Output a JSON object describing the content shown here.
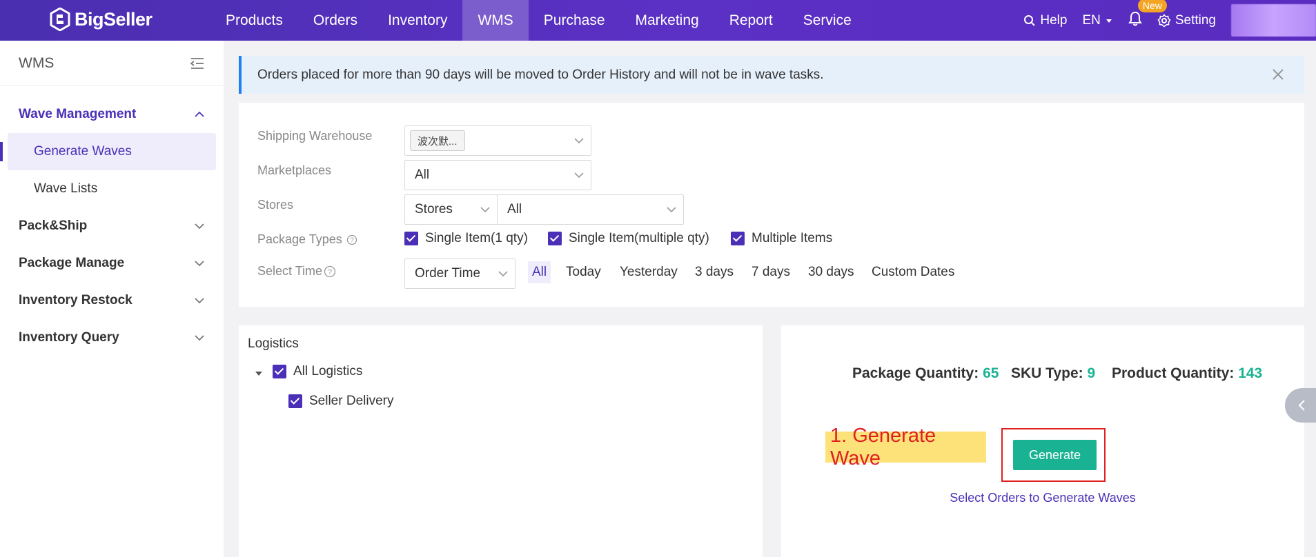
{
  "brand": "BigSeller",
  "nav": {
    "items": [
      "Products",
      "Orders",
      "Inventory",
      "WMS",
      "Purchase",
      "Marketing",
      "Report",
      "Service"
    ],
    "active": "WMS"
  },
  "topbar": {
    "help": "Help",
    "lang": "EN",
    "new_badge": "New",
    "setting": "Setting"
  },
  "sidebar": {
    "title": "WMS",
    "wave_management": "Wave Management",
    "generate_waves": "Generate Waves",
    "wave_lists": "Wave Lists",
    "pack_ship": "Pack&Ship",
    "package_manage": "Package Manage",
    "inventory_restock": "Inventory Restock",
    "inventory_query": "Inventory Query"
  },
  "alert": {
    "text": "Orders placed for more than 90 days will be moved to Order History and will not be in wave tasks."
  },
  "filters": {
    "shipping_warehouse_label": "Shipping Warehouse",
    "shipping_warehouse_tag": "波次默...",
    "marketplaces_label": "Marketplaces",
    "marketplaces_value": "All",
    "stores_label": "Stores",
    "stores_type": "Stores",
    "stores_value": "All",
    "package_types_label": "Package Types",
    "package_types": [
      "Single Item(1 qty)",
      "Single Item(multiple qty)",
      "Multiple Items"
    ],
    "select_time_label": "Select Time",
    "time_type": "Order Time",
    "time_options": [
      "All",
      "Today",
      "Yesterday",
      "3 days",
      "7 days",
      "30 days",
      "Custom Dates"
    ]
  },
  "logistics": {
    "title": "Logistics",
    "all": "All Logistics",
    "child": "Seller Delivery"
  },
  "summary": {
    "package_label": "Package Quantity:",
    "package_value": "65",
    "sku_label": "SKU Type:",
    "sku_value": "9",
    "product_label": "Product Quantity:",
    "product_value": "143",
    "annotation": "1. Generate Wave",
    "generate_button": "Generate",
    "select_orders_link": "Select Orders to Generate Waves"
  },
  "colors": {
    "brand_purple": "#4b30b7",
    "accent_green": "#19b394",
    "alert_blue": "#1f7ef2",
    "annotation_red": "#e02020"
  }
}
